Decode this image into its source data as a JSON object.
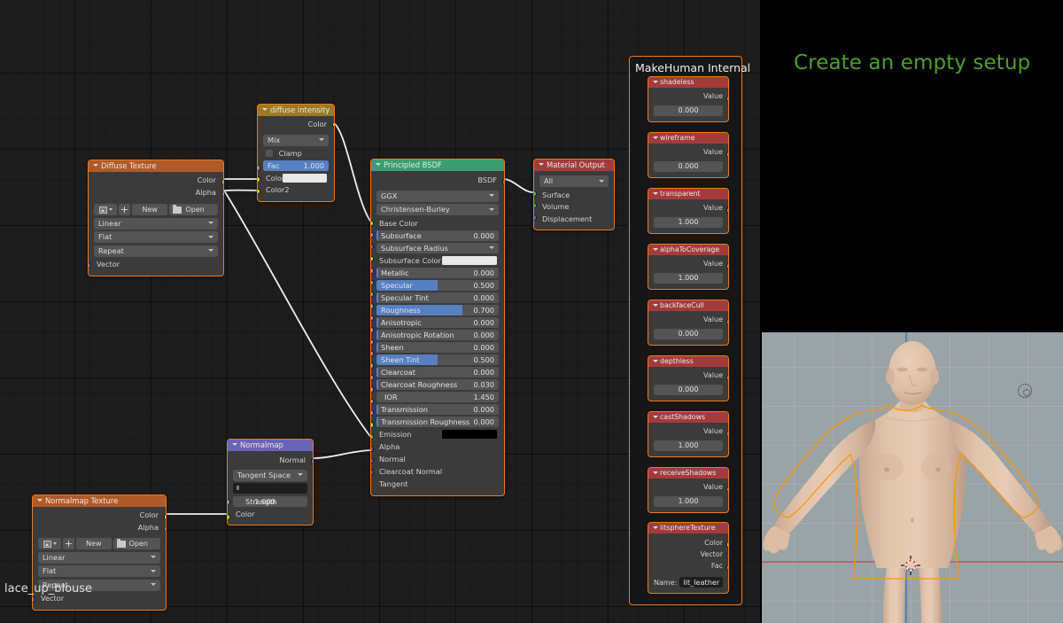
{
  "app": {
    "editor": "blender-node-editor"
  },
  "overlay": {
    "title": "Create an empty setup"
  },
  "canvas_label": {
    "text": "lace_up_blouse"
  },
  "nodes": {
    "diffuse_texture": {
      "title": "Diffuse Texture",
      "outputs": [
        "Color",
        "Alpha"
      ],
      "image_bar": {
        "new": "New",
        "open": "Open"
      },
      "interpolation": "Linear",
      "projection": "Flat",
      "extension": "Repeat",
      "input": "Vector"
    },
    "diffuse_intensity": {
      "title": "diffuse intensity",
      "output": "Color",
      "blend_mode": "Mix",
      "clamp_label": "Clamp",
      "fac": {
        "label": "Fac",
        "value": "1.000",
        "fill_pct": 100
      },
      "color1": "Color1",
      "color2": "Color2"
    },
    "principled_bsdf": {
      "title": "Principled BSDF",
      "output": "BSDF",
      "distribution": "GGX",
      "subsurface_method": "Christensen-Burley",
      "props": [
        {
          "label": "Base Color",
          "value": "",
          "type": "socket_text",
          "socket": "y"
        },
        {
          "label": "Subsurface",
          "value": "0.000",
          "type": "slider",
          "fill_pct": 1,
          "socket": "gr"
        },
        {
          "label": "Subsurface Radius",
          "value": "",
          "type": "dropdown",
          "socket": "b"
        },
        {
          "label": "Subsurface Color",
          "value": "",
          "type": "swatch",
          "socket": "y"
        },
        {
          "label": "Metallic",
          "value": "0.000",
          "type": "slider",
          "fill_pct": 1,
          "socket": "gr"
        },
        {
          "label": "Specular",
          "value": "0.500",
          "type": "slider",
          "fill_pct": 50,
          "socket": "gr"
        },
        {
          "label": "Specular Tint",
          "value": "0.000",
          "type": "slider",
          "fill_pct": 1,
          "socket": "gr"
        },
        {
          "label": "Roughness",
          "value": "0.700",
          "type": "slider",
          "fill_pct": 70,
          "socket": "gr"
        },
        {
          "label": "Anisotropic",
          "value": "0.000",
          "type": "slider",
          "fill_pct": 1,
          "socket": "gr"
        },
        {
          "label": "Anisotropic Rotation",
          "value": "0.000",
          "type": "slider",
          "fill_pct": 1,
          "socket": "gr"
        },
        {
          "label": "Sheen",
          "value": "0.000",
          "type": "slider",
          "fill_pct": 1,
          "socket": "gr"
        },
        {
          "label": "Sheen Tint",
          "value": "0.500",
          "type": "slider",
          "fill_pct": 50,
          "socket": "gr"
        },
        {
          "label": "Clearcoat",
          "value": "0.000",
          "type": "slider",
          "fill_pct": 1,
          "socket": "gr"
        },
        {
          "label": "Clearcoat Roughness",
          "value": "0.030",
          "type": "slider",
          "fill_pct": 3,
          "socket": "gr"
        },
        {
          "label": "IOR",
          "value": "1.450",
          "type": "slider",
          "fill_pct": 0,
          "socket": "gr"
        },
        {
          "label": "Transmission",
          "value": "0.000",
          "type": "slider",
          "fill_pct": 1,
          "socket": "gr"
        },
        {
          "label": "Transmission Roughness",
          "value": "0.000",
          "type": "slider",
          "fill_pct": 1,
          "socket": "gr"
        },
        {
          "label": "Emission",
          "value": "",
          "type": "swatch_black",
          "socket": "y"
        },
        {
          "label": "Alpha",
          "value": "",
          "type": "socket_text",
          "socket": "gr"
        },
        {
          "label": "Normal",
          "value": "",
          "type": "socket_text",
          "socket": "b"
        },
        {
          "label": "Clearcoat Normal",
          "value": "",
          "type": "socket_text",
          "socket": "b"
        },
        {
          "label": "Tangent",
          "value": "",
          "type": "socket_text",
          "socket": "b"
        }
      ]
    },
    "material_output": {
      "title": "Material Output",
      "target": "All",
      "inputs": [
        "Surface",
        "Volume",
        "Displacement"
      ]
    },
    "normalmap": {
      "title": "Normalmap",
      "output": "Normal",
      "space": "Tangent Space",
      "uv_map": "",
      "strength": {
        "label": "Strength",
        "value": "1.000"
      },
      "color_input": "Color"
    },
    "normalmap_texture": {
      "title": "Normalmap Texture",
      "outputs": [
        "Color",
        "Alpha"
      ],
      "image_bar": {
        "new": "New",
        "open": "Open"
      },
      "interpolation": "Linear",
      "projection": "Flat",
      "extension": "Repeat",
      "input": "Vector"
    }
  },
  "frame": {
    "title": "MakeHuman Internal",
    "value_label": "Value",
    "nodes": [
      {
        "title": "shadeless",
        "value": "0.000"
      },
      {
        "title": "wireframe",
        "value": "0.000"
      },
      {
        "title": "transparent",
        "value": "1.000"
      },
      {
        "title": "alphaToCoverage",
        "value": "1.000"
      },
      {
        "title": "backfaceCull",
        "value": "0.000"
      },
      {
        "title": "depthless",
        "value": "0.000"
      },
      {
        "title": "castShadows",
        "value": "1.000"
      },
      {
        "title": "receiveShadows",
        "value": "1.000"
      }
    ],
    "texture_node": {
      "title": "litsphereTexture",
      "outputs": [
        "Color",
        "Vector",
        "Fac"
      ],
      "name_label": "Name:",
      "name_value": "lit_leather"
    }
  },
  "colors": {
    "node_border": "#f07a1e",
    "header_orange": "#b05a28",
    "header_gold": "#9b7a22",
    "header_green": "#3c9e6e",
    "header_red": "#a33b3b",
    "header_purple": "#6b63b5",
    "slider_fill": "#5680c2",
    "overlay_green": "#4a9e28",
    "viewport_bg": "#9aa3a6",
    "selection_outline": "#ff9500"
  }
}
